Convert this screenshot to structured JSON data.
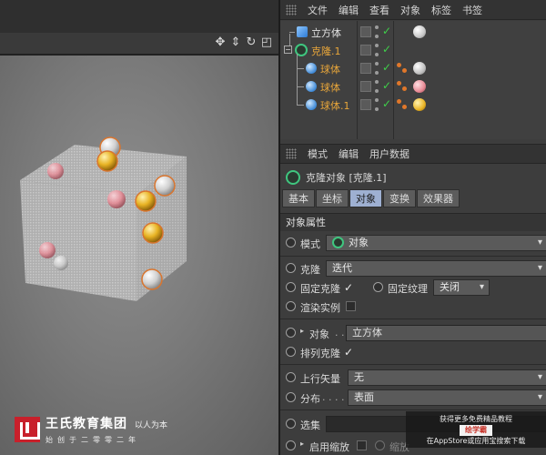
{
  "menubar": {
    "items": [
      "文件",
      "编辑",
      "查看",
      "对象",
      "标签",
      "书签"
    ]
  },
  "objects": [
    {
      "name": "立方体",
      "color": "white",
      "icon": "cube-icon",
      "tag_color": "#d4d4d4"
    },
    {
      "name": "克隆.1",
      "color": "orange",
      "icon": "cloner-icon",
      "tag_color": ""
    },
    {
      "name": "球体",
      "color": "orange",
      "icon": "sphere-icon",
      "tag_color": "#c0c0c0"
    },
    {
      "name": "球体",
      "color": "orange",
      "icon": "sphere-icon",
      "tag_color": "#e88a95"
    },
    {
      "name": "球体.1",
      "color": "orange",
      "icon": "sphere-icon",
      "tag_color": "#e8b324"
    }
  ],
  "attrbar": {
    "items": [
      "模式",
      "编辑",
      "用户数据"
    ]
  },
  "attr_title": "克隆对象 [克隆.1]",
  "tabs": [
    {
      "label": "基本",
      "active": false
    },
    {
      "label": "坐标",
      "active": false
    },
    {
      "label": "对象",
      "active": true
    },
    {
      "label": "变换",
      "active": false
    },
    {
      "label": "效果器",
      "active": false
    }
  ],
  "section": "对象属性",
  "props": {
    "mode_label": "模式",
    "mode_value": "对象",
    "clone_label": "克隆",
    "clone_value": "迭代",
    "fixed_clone_label": "固定克隆",
    "fixed_texture_label": "固定纹理",
    "fixed_texture_value": "关闭",
    "render_instance_label": "渲染实例",
    "object_label": "对象",
    "object_value": "立方体",
    "arrange_label": "排列克隆",
    "up_vector_label": "上行矢量",
    "up_vector_value": "无",
    "distribution_label": "分布",
    "distribution_value": "表面",
    "selection_label": "选集",
    "enable_scale_label": "启用缩放",
    "scale_label": "缩放"
  },
  "logo": {
    "name": "王氏教育集团",
    "slogan": "以人为本",
    "since": "始创于二零零二年"
  },
  "watermark": {
    "line1": "获得更多免费精品教程",
    "line2": "绘学霸",
    "line3": "在AppStore或应用宝搜索下载"
  }
}
